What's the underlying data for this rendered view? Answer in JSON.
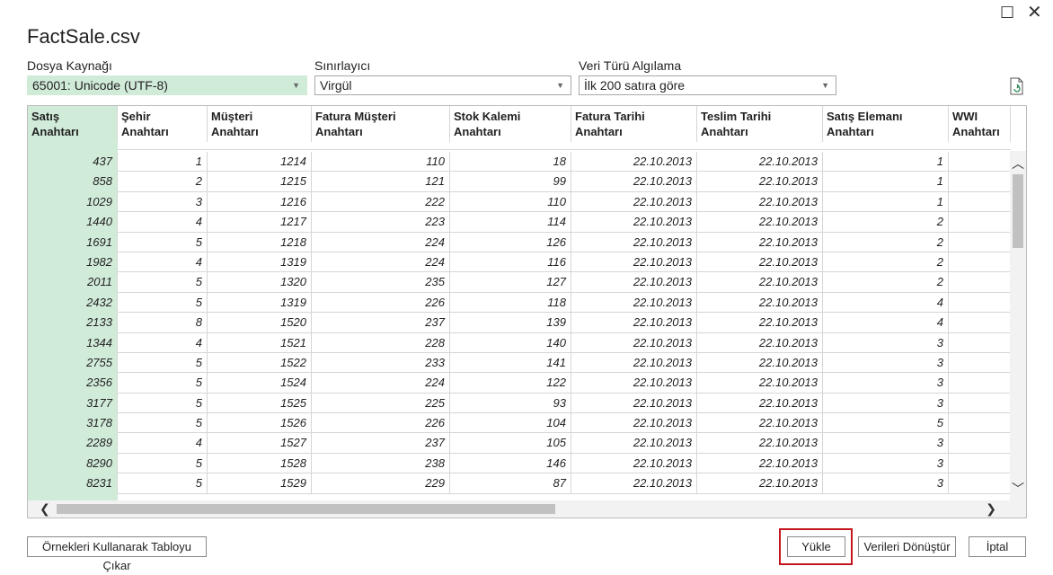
{
  "window": {
    "title": "FactSale.csv",
    "maximize_glyph": "☐",
    "close_glyph": "✕"
  },
  "options": {
    "file_origin": {
      "label": "Dosya Kaynağı",
      "value": "65001: Unicode (UTF-8)"
    },
    "delimiter": {
      "label": "Sınırlayıcı",
      "value": "Virgül"
    },
    "type_detection": {
      "label": "Veri Türü Algılama",
      "value": "İlk 200 satıra göre"
    },
    "refresh_icon": "refresh-document-icon"
  },
  "table": {
    "columns": [
      "Satış\nAnahtarı",
      "Şehir\nAnahtarı",
      "Müşteri\nAnahtarı",
      "Fatura Müşteri\nAnahtarı",
      "Stok Kalemi\nAnahtarı",
      "Fatura Tarihi\nAnahtarı",
      "Teslim Tarihi\nAnahtarı",
      "Satış Elemanı\nAnahtarı",
      "WWI\nAnahtarı"
    ],
    "selected_column": 0,
    "rows": [
      [
        "437",
        "1",
        "1214",
        "110",
        "18",
        "22.10.2013",
        "22.10.2013",
        "1",
        ""
      ],
      [
        "858",
        "2",
        "1215",
        "121",
        "99",
        "22.10.2013",
        "22.10.2013",
        "1",
        ""
      ],
      [
        "1029",
        "3",
        "1216",
        "222",
        "110",
        "22.10.2013",
        "22.10.2013",
        "1",
        ""
      ],
      [
        "1440",
        "4",
        "1217",
        "223",
        "114",
        "22.10.2013",
        "22.10.2013",
        "2",
        ""
      ],
      [
        "1691",
        "5",
        "1218",
        "224",
        "126",
        "22.10.2013",
        "22.10.2013",
        "2",
        ""
      ],
      [
        "1982",
        "4",
        "1319",
        "224",
        "116",
        "22.10.2013",
        "22.10.2013",
        "2",
        ""
      ],
      [
        "2011",
        "5",
        "1320",
        "235",
        "127",
        "22.10.2013",
        "22.10.2013",
        "2",
        ""
      ],
      [
        "2432",
        "5",
        "1319",
        "226",
        "118",
        "22.10.2013",
        "22.10.2013",
        "4",
        ""
      ],
      [
        "2133",
        "8",
        "1520",
        "237",
        "139",
        "22.10.2013",
        "22.10.2013",
        "4",
        ""
      ],
      [
        "1344",
        "4",
        "1521",
        "228",
        "140",
        "22.10.2013",
        "22.10.2013",
        "3",
        ""
      ],
      [
        "2755",
        "5",
        "1522",
        "233",
        "141",
        "22.10.2013",
        "22.10.2013",
        "3",
        ""
      ],
      [
        "2356",
        "5",
        "1524",
        "224",
        "122",
        "22.10.2013",
        "22.10.2013",
        "3",
        ""
      ],
      [
        "3177",
        "5",
        "1525",
        "225",
        "93",
        "22.10.2013",
        "22.10.2013",
        "3",
        ""
      ],
      [
        "3178",
        "5",
        "1526",
        "226",
        "104",
        "22.10.2013",
        "22.10.2013",
        "5",
        ""
      ],
      [
        "2289",
        "4",
        "1527",
        "237",
        "105",
        "22.10.2013",
        "22.10.2013",
        "3",
        ""
      ],
      [
        "8290",
        "5",
        "1528",
        "238",
        "146",
        "22.10.2013",
        "22.10.2013",
        "3",
        ""
      ],
      [
        "8231",
        "5",
        "1529",
        "229",
        "87",
        "22.10.2013",
        "22.10.2013",
        "3",
        ""
      ]
    ]
  },
  "buttons": {
    "extract": "Örnekleri Kullanarak Tabloyu Çıkar",
    "load": "Yükle",
    "transform": "Verileri Dönüştür",
    "cancel": "İptal"
  },
  "colors": {
    "selected_column": "#d1ebd9",
    "highlight_border": "#c4161c"
  }
}
